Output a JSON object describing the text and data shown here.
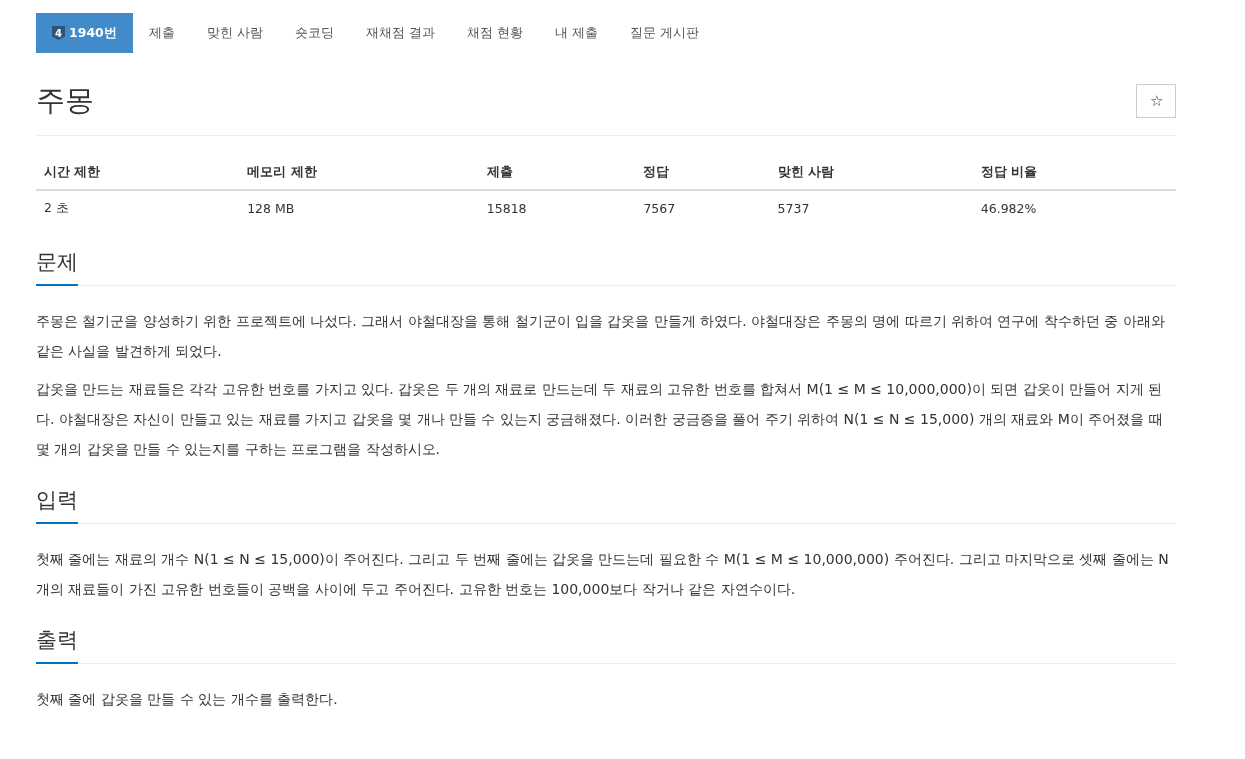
{
  "nav": {
    "tabs": [
      {
        "label": "1940번",
        "tier": "4",
        "selected": true
      },
      {
        "label": "제출",
        "selected": false
      },
      {
        "label": "맞힌 사람",
        "selected": false
      },
      {
        "label": "숏코딩",
        "selected": false
      },
      {
        "label": "재채점 결과",
        "selected": false
      },
      {
        "label": "채점 현황",
        "selected": false
      },
      {
        "label": "내 제출",
        "selected": false
      },
      {
        "label": "질문 게시판",
        "selected": false
      }
    ]
  },
  "problem": {
    "title": "주몽",
    "star": "☆"
  },
  "stats": {
    "columns": [
      "시간 제한",
      "메모리 제한",
      "제출",
      "정답",
      "맞힌 사람",
      "정답 비율"
    ],
    "row": [
      "2 초",
      "128 MB",
      "15818",
      "7567",
      "5737",
      "46.982%"
    ]
  },
  "sections": [
    {
      "heading": "문제",
      "paragraphs": [
        "주몽은 철기군을 양성하기 위한 프로젝트에 나섰다. 그래서 야철대장을 통해 철기군이 입을 갑옷을 만들게 하였다. 야철대장은 주몽의 명에 따르기 위하여 연구에 착수하던 중 아래와 같은 사실을 발견하게 되었다.",
        "갑옷을 만드는 재료들은 각각 고유한 번호를 가지고 있다. 갑옷은 두 개의 재료로 만드는데 두 재료의 고유한 번호를 합쳐서 M(1 ≤ M ≤ 10,000,000)이 되면 갑옷이 만들어 지게 된다. 야철대장은 자신이 만들고 있는 재료를 가지고 갑옷을 몇 개나 만들 수 있는지 궁금해졌다. 이러한 궁금증을 풀어 주기 위하여 N(1 ≤ N ≤ 15,000) 개의 재료와 M이 주어졌을 때 몇 개의 갑옷을 만들 수 있는지를 구하는 프로그램을 작성하시오."
      ]
    },
    {
      "heading": "입력",
      "paragraphs": [
        "첫째 줄에는 재료의 개수 N(1 ≤ N ≤ 15,000)이 주어진다. 그리고 두 번째 줄에는 갑옷을 만드는데 필요한 수 M(1 ≤ M ≤ 10,000,000) 주어진다. 그리고 마지막으로 셋째 줄에는 N개의 재료들이 가진 고유한 번호들이 공백을 사이에 두고 주어진다. 고유한 번호는 100,000보다 작거나 같은 자연수이다."
      ]
    },
    {
      "heading": "출력",
      "paragraphs": [
        "첫째 줄에 갑옷을 만들 수 있는 개수를 출력한다."
      ]
    }
  ]
}
